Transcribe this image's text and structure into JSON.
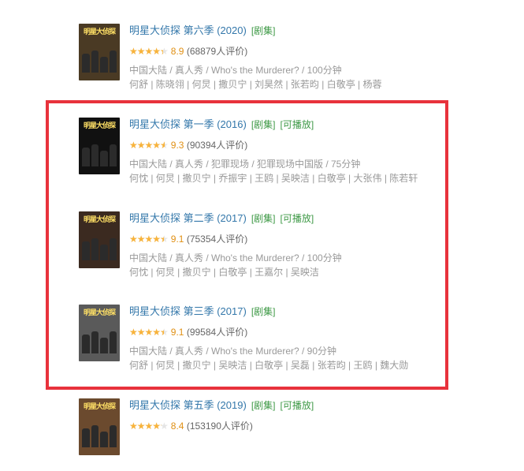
{
  "items": [
    {
      "title": "明星大侦探 第六季 (2020)",
      "tags": [
        "[剧集]"
      ],
      "score": "8.9",
      "rating_fraction": 0.89,
      "votes": "(68879人评价)",
      "meta": "中国大陆 / 真人秀 / Who's the Murderer? / 100分钟",
      "cast": "何舒 | 陈晓翎 | 何炅 | 撒贝宁 | 刘昊然 | 张若昀 | 白敬亭 | 杨蓉",
      "poster_color": "#4a3a24",
      "poster_text": "明星大侦探"
    },
    {
      "title": "明星大侦探 第一季 (2016)",
      "tags": [
        "[剧集]",
        "[可播放]"
      ],
      "score": "9.3",
      "rating_fraction": 0.93,
      "votes": "(90394人评价)",
      "meta": "中国大陆 / 真人秀 / 犯罪现场 / 犯罪现场中国版 / 75分钟",
      "cast": "何忱 | 何炅 | 撒贝宁 | 乔振宇 | 王鸥 | 吴映洁 | 白敬亭 | 大张伟 | 陈若轩",
      "poster_color": "#111111",
      "poster_text": "明星大侦探"
    },
    {
      "title": "明星大侦探 第二季 (2017)",
      "tags": [
        "[剧集]",
        "[可播放]"
      ],
      "score": "9.1",
      "rating_fraction": 0.91,
      "votes": "(75354人评价)",
      "meta": "中国大陆 / 真人秀 / Who's the Murderer? / 100分钟",
      "cast": "何忱 | 何炅 | 撒贝宁 | 白敬亭 | 王嘉尔 | 吴映洁",
      "poster_color": "#3b2a20",
      "poster_text": "明星大侦探"
    },
    {
      "title": "明星大侦探 第三季 (2017)",
      "tags": [
        "[剧集]"
      ],
      "score": "9.1",
      "rating_fraction": 0.91,
      "votes": "(99584人评价)",
      "meta": "中国大陆 / 真人秀 / Who's the Murderer? / 90分钟",
      "cast": "何舒 | 何炅 | 撒贝宁 | 吴映洁 | 白敬亭 | 吴磊 | 张若昀 | 王鸥 | 魏大勋",
      "poster_color": "#5a5a5a",
      "poster_text": "明星大侦探"
    },
    {
      "title": "明星大侦探 第五季 (2019)",
      "tags": [
        "[剧集]",
        "[可播放]"
      ],
      "score": "8.4",
      "rating_fraction": 0.84,
      "votes": "(153190人评价)",
      "meta": "",
      "cast": "",
      "poster_color": "#6b4a2e",
      "poster_text": "明星大侦探"
    }
  ],
  "colors": {
    "title": "#3377aa",
    "tag": "#3e9946",
    "star": "#f8b33b",
    "highlight": "#e8323c"
  }
}
